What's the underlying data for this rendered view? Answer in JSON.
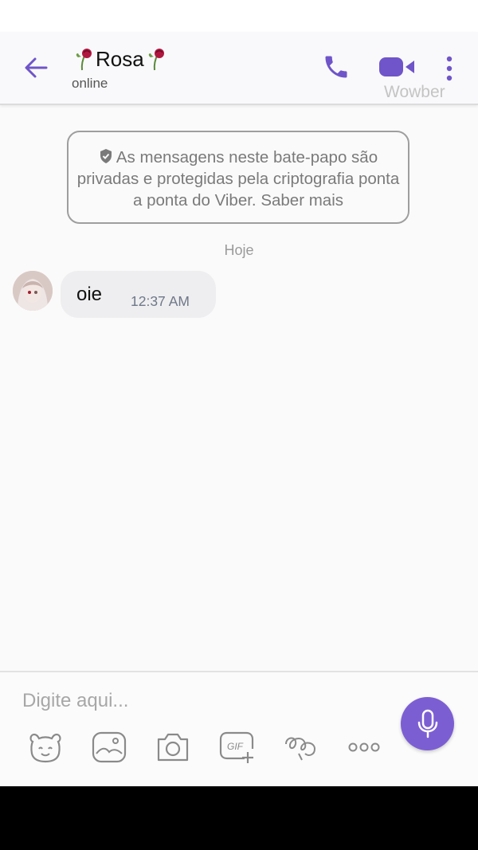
{
  "header": {
    "contact_name": "Rosa",
    "contact_status": "online",
    "watermark": "Wowber"
  },
  "notice": {
    "text": "As mensagens neste bate-papo são privadas e protegidas pela criptografia ponta a ponta do Viber. Saber mais"
  },
  "conversation": {
    "date_label": "Hoje",
    "messages": [
      {
        "text": "oie",
        "time": "12:37 AM"
      }
    ]
  },
  "composer": {
    "placeholder": "Digite aqui..."
  },
  "colors": {
    "accent": "#7c5ed3",
    "bubble": "#eeeef0",
    "icon_gray": "#8a8a8a"
  },
  "icons": {
    "header": [
      "back-arrow-icon",
      "rose-emoji-icon",
      "phone-icon",
      "video-camera-icon",
      "more-vertical-icon"
    ],
    "toolbar": [
      "sticker-bear-icon",
      "gallery-icon",
      "camera-icon",
      "gif-icon",
      "doodle-icon",
      "more-horizontal-icon"
    ],
    "send": "microphone-icon"
  }
}
